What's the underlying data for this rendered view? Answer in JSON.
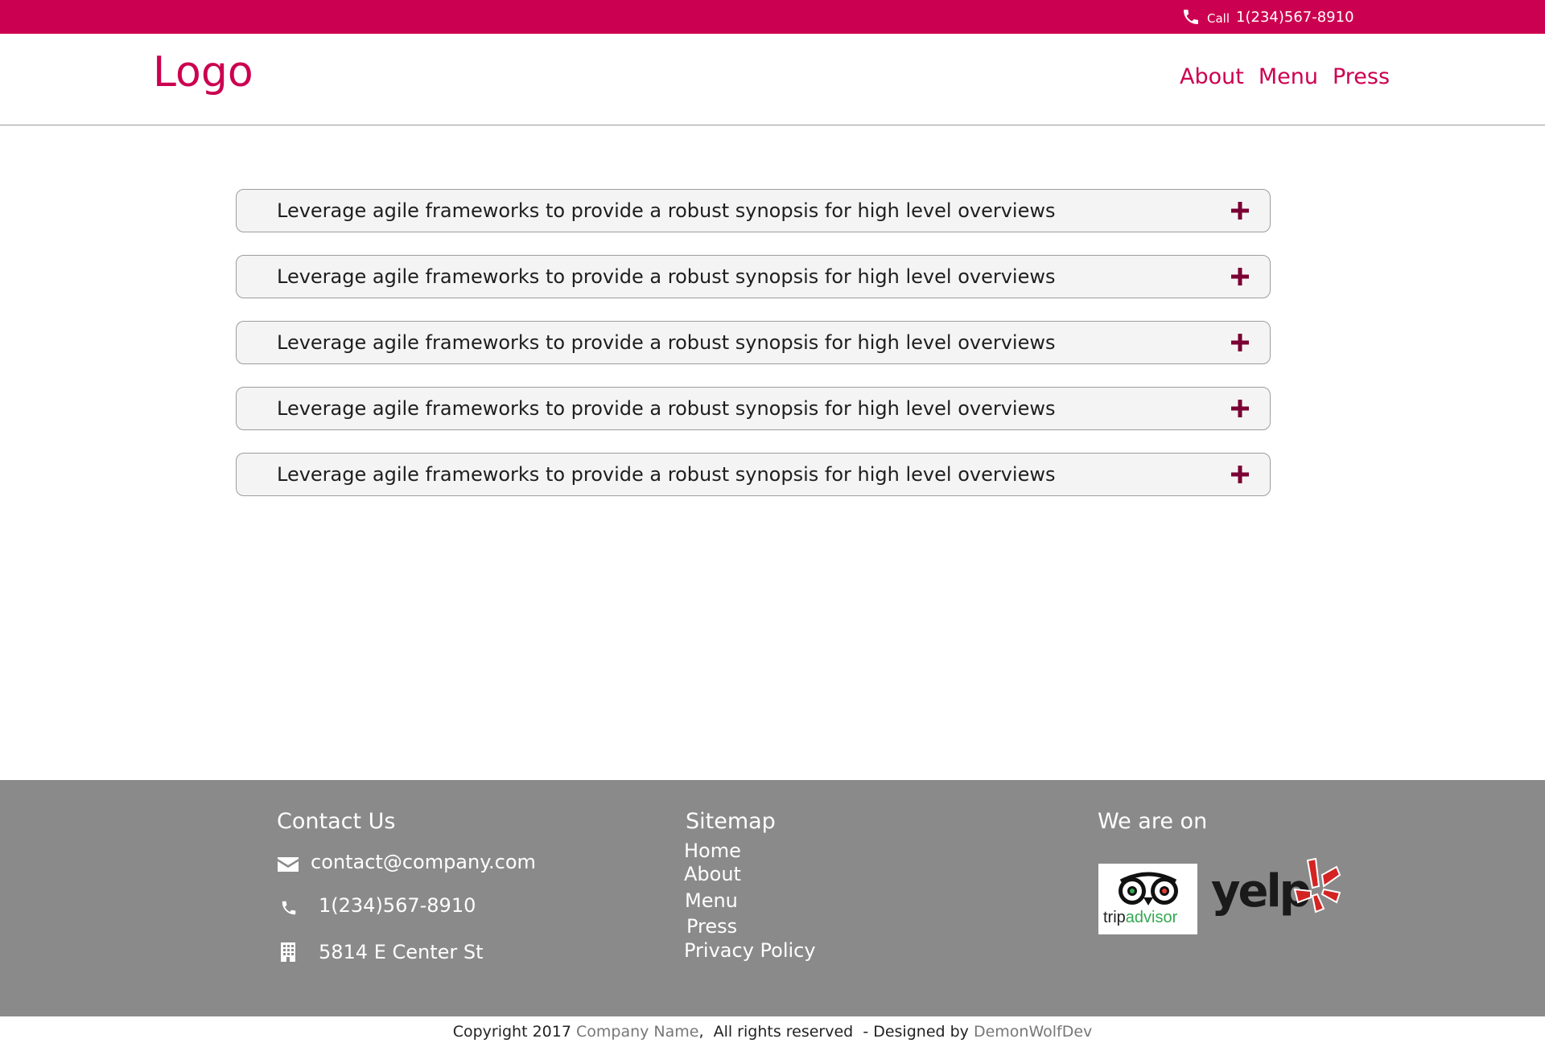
{
  "topbar": {
    "call_word": "Call",
    "phone_number": "1(234)567-8910",
    "background_color": "#cc0050"
  },
  "header": {
    "logo_text": "Logo",
    "nav": [
      {
        "label": "About"
      },
      {
        "label": "Menu"
      },
      {
        "label": "Press"
      }
    ],
    "accent_color": "#cc0050"
  },
  "accordion": {
    "items": [
      {
        "label": "Leverage agile frameworks to provide a robust synopsis for high level overviews",
        "icon": "plus-icon"
      },
      {
        "label": "Leverage agile frameworks to provide a robust synopsis for high level overviews",
        "icon": "plus-icon"
      },
      {
        "label": "Leverage agile frameworks to provide a robust synopsis for high level overviews",
        "icon": "plus-icon"
      },
      {
        "label": "Leverage agile frameworks to provide a robust synopsis for high level overviews",
        "icon": "plus-icon"
      },
      {
        "label": "Leverage agile frameworks to provide a robust synopsis for high level overviews",
        "icon": "plus-icon"
      }
    ],
    "icon_color": "#7a0033"
  },
  "footer": {
    "contact": {
      "heading": "Contact Us",
      "email": "contact@company.com",
      "phone": "1(234)567-8910",
      "address": "5814 E Center St"
    },
    "sitemap": {
      "heading": "Sitemap",
      "links": [
        {
          "label": "Home"
        },
        {
          "label": "About"
        },
        {
          "label": "Menu"
        },
        {
          "label": "Press"
        },
        {
          "label": "Privacy Policy"
        }
      ]
    },
    "social": {
      "heading": "We are on",
      "tripadvisor_logo": "tripadvisor",
      "yelp_logo": "yelp"
    },
    "background_color": "#8a8a8a"
  },
  "copyright": {
    "prefix": "Copyright 2017 ",
    "company": "Company Name",
    "middle": ",  All rights reserved  - Designed by ",
    "designer": "DemonWolfDev"
  }
}
